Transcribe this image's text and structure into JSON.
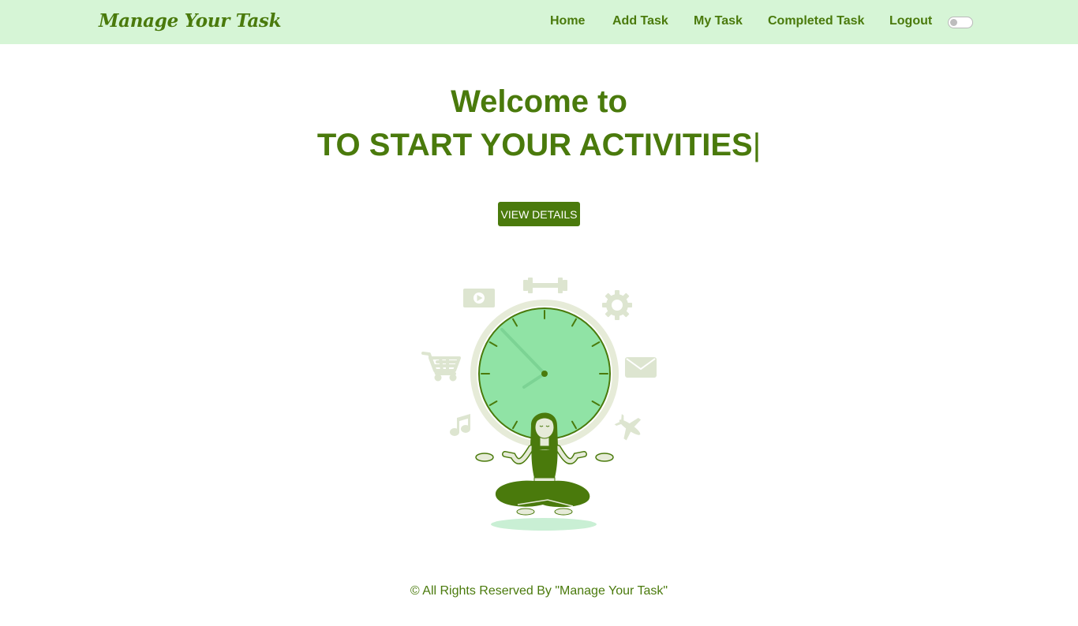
{
  "navbar": {
    "brand": "Manage Your Task",
    "links": [
      "Home",
      "Add Task",
      "My Task",
      "Completed Task",
      "Logout"
    ],
    "theme_toggle": "off"
  },
  "hero": {
    "line1": "Welcome to",
    "line2": "TO START YOUR ACTIVITIES",
    "cursor": "|",
    "button": "VIEW DETAILS"
  },
  "illustration": {
    "subject": "person meditating in front of a clock",
    "icons": [
      "video-icon",
      "dumbbell-icon",
      "gear-icon",
      "shopping-cart-icon",
      "mail-icon",
      "music-note-icon",
      "airplane-icon"
    ]
  },
  "footer": {
    "text": "© All Rights Reserved By \"Manage Your Task\""
  },
  "colors": {
    "primary": "#4a7a0c",
    "navbar_bg": "#d6f5d6",
    "clock_face": "#90e3a5",
    "icon_muted": "#dde5d0"
  }
}
